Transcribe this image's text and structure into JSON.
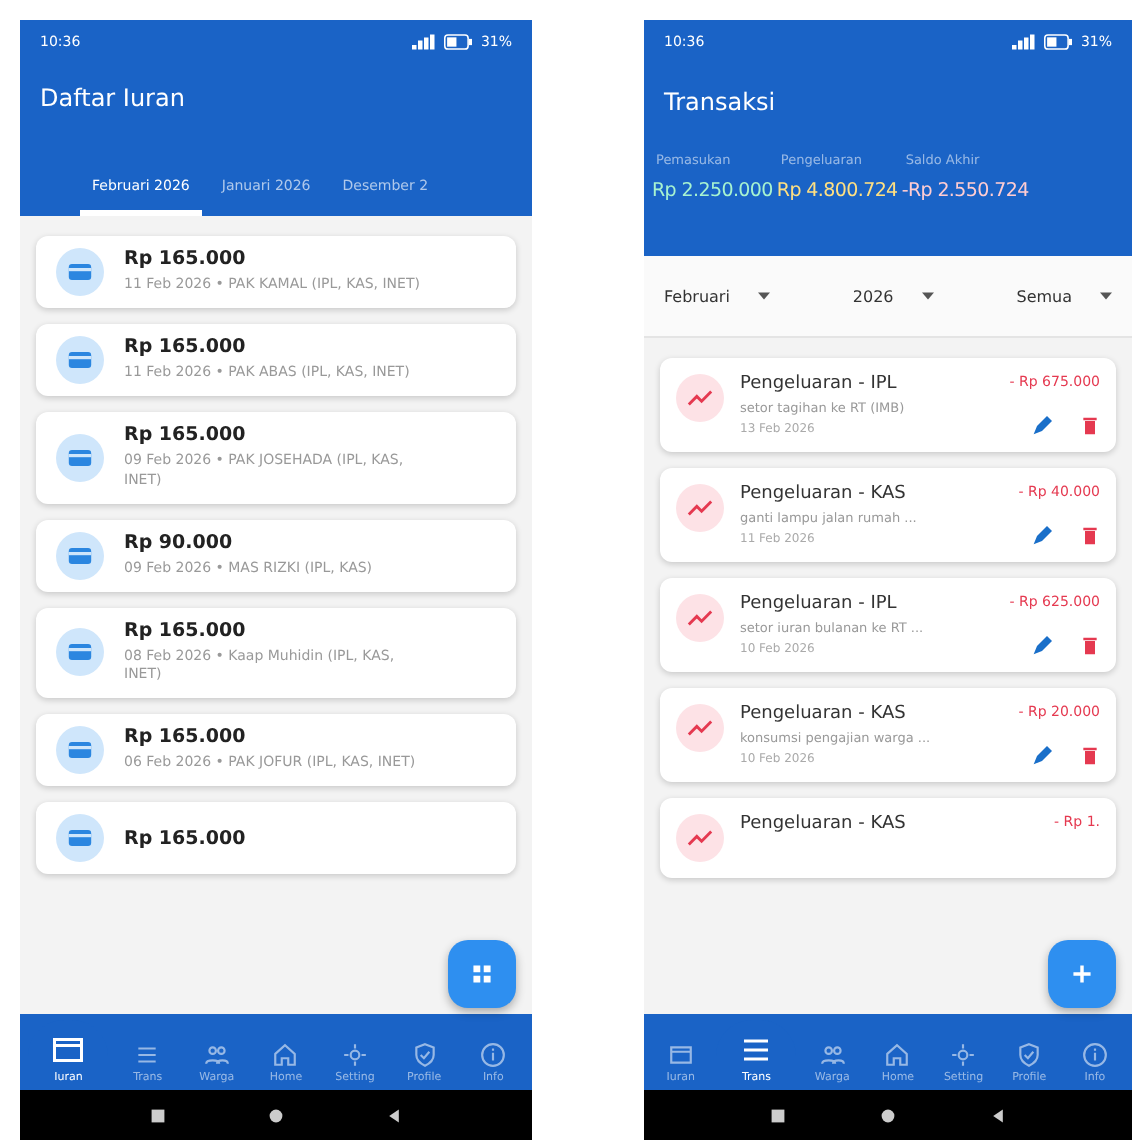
{
  "dues_screen": {
    "status_bar": {
      "time": "10:36",
      "battery": "31%"
    },
    "title": "Daftar Iuran",
    "tabs": [
      {
        "label": "Februari 2026",
        "selected": true
      },
      {
        "label": "Januari 2026",
        "selected": false
      },
      {
        "label": "Desember 2",
        "selected": false
      }
    ],
    "dues": [
      {
        "amount": "Rp 165.000",
        "detail": "11 Feb 2026 • PAK KAMAL (IPL, KAS, INET)"
      },
      {
        "amount": "Rp 165.000",
        "detail": "11 Feb 2026 • PAK ABAS (IPL, KAS, INET)"
      },
      {
        "amount": "Rp 165.000",
        "detail": "09 Feb 2026 • PAK JOSEHADA (IPL, KAS, INET)"
      },
      {
        "amount": "Rp 90.000",
        "detail": "09 Feb 2026 • MAS RIZKI (IPL, KAS)"
      },
      {
        "amount": "Rp 165.000",
        "detail": "08 Feb 2026 • Kaap Muhidin (IPL, KAS, INET)"
      },
      {
        "amount": "Rp 165.000",
        "detail": "06 Feb 2026 • PAK JOFUR (IPL, KAS, INET)"
      },
      {
        "amount": "Rp 165.000"
      }
    ],
    "nav": [
      {
        "label": "Iuran",
        "selected": true
      },
      {
        "label": "Trans",
        "selected": false
      },
      {
        "label": "Warga",
        "selected": false
      },
      {
        "label": "Home",
        "selected": false
      },
      {
        "label": "Setting",
        "selected": false
      },
      {
        "label": "Profile",
        "selected": false
      },
      {
        "label": "Info",
        "selected": false
      }
    ]
  },
  "transactions_screen": {
    "status_bar": {
      "time": "10:36",
      "battery": "31%"
    },
    "title": "Transaksi",
    "summary": [
      {
        "label": "Pemasukan",
        "value": "Rp 2.250.000"
      },
      {
        "label": "Pengeluaran",
        "value": "Rp 4.800.724"
      },
      {
        "label": "Saldo Akhir",
        "value": "-Rp 2.550.724"
      }
    ],
    "filters": [
      {
        "value": "Februari"
      },
      {
        "value": "2026"
      },
      {
        "value": "Semua"
      }
    ],
    "transactions": [
      {
        "title": "Pengeluaran - IPL",
        "amount": "- Rp 675.000",
        "description": "setor tagihan ke RT (IMB)",
        "date": "13 Feb 2026"
      },
      {
        "title": "Pengeluaran - KAS",
        "amount": "- Rp 40.000",
        "description": "ganti lampu jalan rumah ...",
        "date": "11 Feb 2026"
      },
      {
        "title": "Pengeluaran - IPL",
        "amount": "- Rp 625.000",
        "description": "setor iuran bulanan ke RT ...",
        "date": "10 Feb 2026"
      },
      {
        "title": "Pengeluaran - KAS",
        "amount": "- Rp 20.000",
        "description": "konsumsi pengajian warga ...",
        "date": "10 Feb 2026"
      },
      {
        "title": "Pengeluaran - KAS",
        "amount": "- Rp 1."
      }
    ],
    "nav": [
      {
        "label": "Iuran",
        "selected": false
      },
      {
        "label": "Trans",
        "selected": true
      },
      {
        "label": "Warga",
        "selected": false
      },
      {
        "label": "Home",
        "selected": false
      },
      {
        "label": "Setting",
        "selected": false
      },
      {
        "label": "Profile",
        "selected": false
      },
      {
        "label": "Info",
        "selected": false
      }
    ]
  }
}
